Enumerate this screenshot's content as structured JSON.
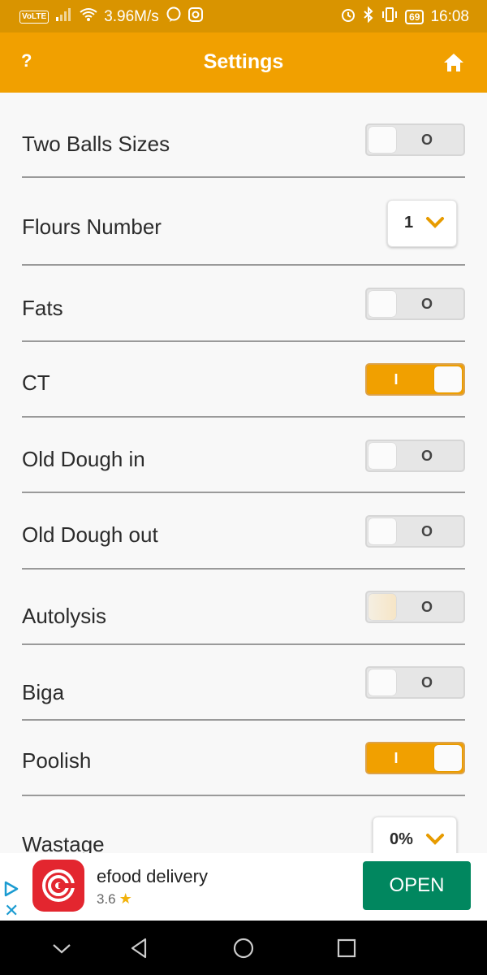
{
  "status_bar": {
    "volte": "VoLTE",
    "speed": "3.96M/s",
    "battery": "69",
    "time": "16:08"
  },
  "app_bar": {
    "help_label": "?",
    "title": "Settings"
  },
  "settings": [
    {
      "label": "Two Balls Sizes",
      "type": "toggle",
      "state": "O"
    },
    {
      "label": "Flours Number",
      "type": "dropdown",
      "value": "1"
    },
    {
      "label": "Fats",
      "type": "toggle",
      "state": "O"
    },
    {
      "label": "CT",
      "type": "toggle",
      "state": "I"
    },
    {
      "label": "Old Dough in",
      "type": "toggle",
      "state": "O"
    },
    {
      "label": "Old Dough out",
      "type": "toggle",
      "state": "O"
    },
    {
      "label": "Autolysis",
      "type": "toggle",
      "state": "O"
    },
    {
      "label": "Biga",
      "type": "toggle",
      "state": "O"
    },
    {
      "label": "Poolish",
      "type": "toggle",
      "state": "I"
    },
    {
      "label": "Wastage",
      "type": "dropdown",
      "value": "0%"
    }
  ],
  "ad": {
    "app_name": "efood delivery",
    "rating": "3.6",
    "star": "★",
    "close": "✕",
    "button": "OPEN"
  },
  "colors": {
    "status_bar": "#d99400",
    "app_bar": "#f1a000",
    "toggle_on": "#f1a000",
    "chevron": "#e79b00",
    "ad_button": "#01875f",
    "ad_logo": "#e3262f"
  }
}
